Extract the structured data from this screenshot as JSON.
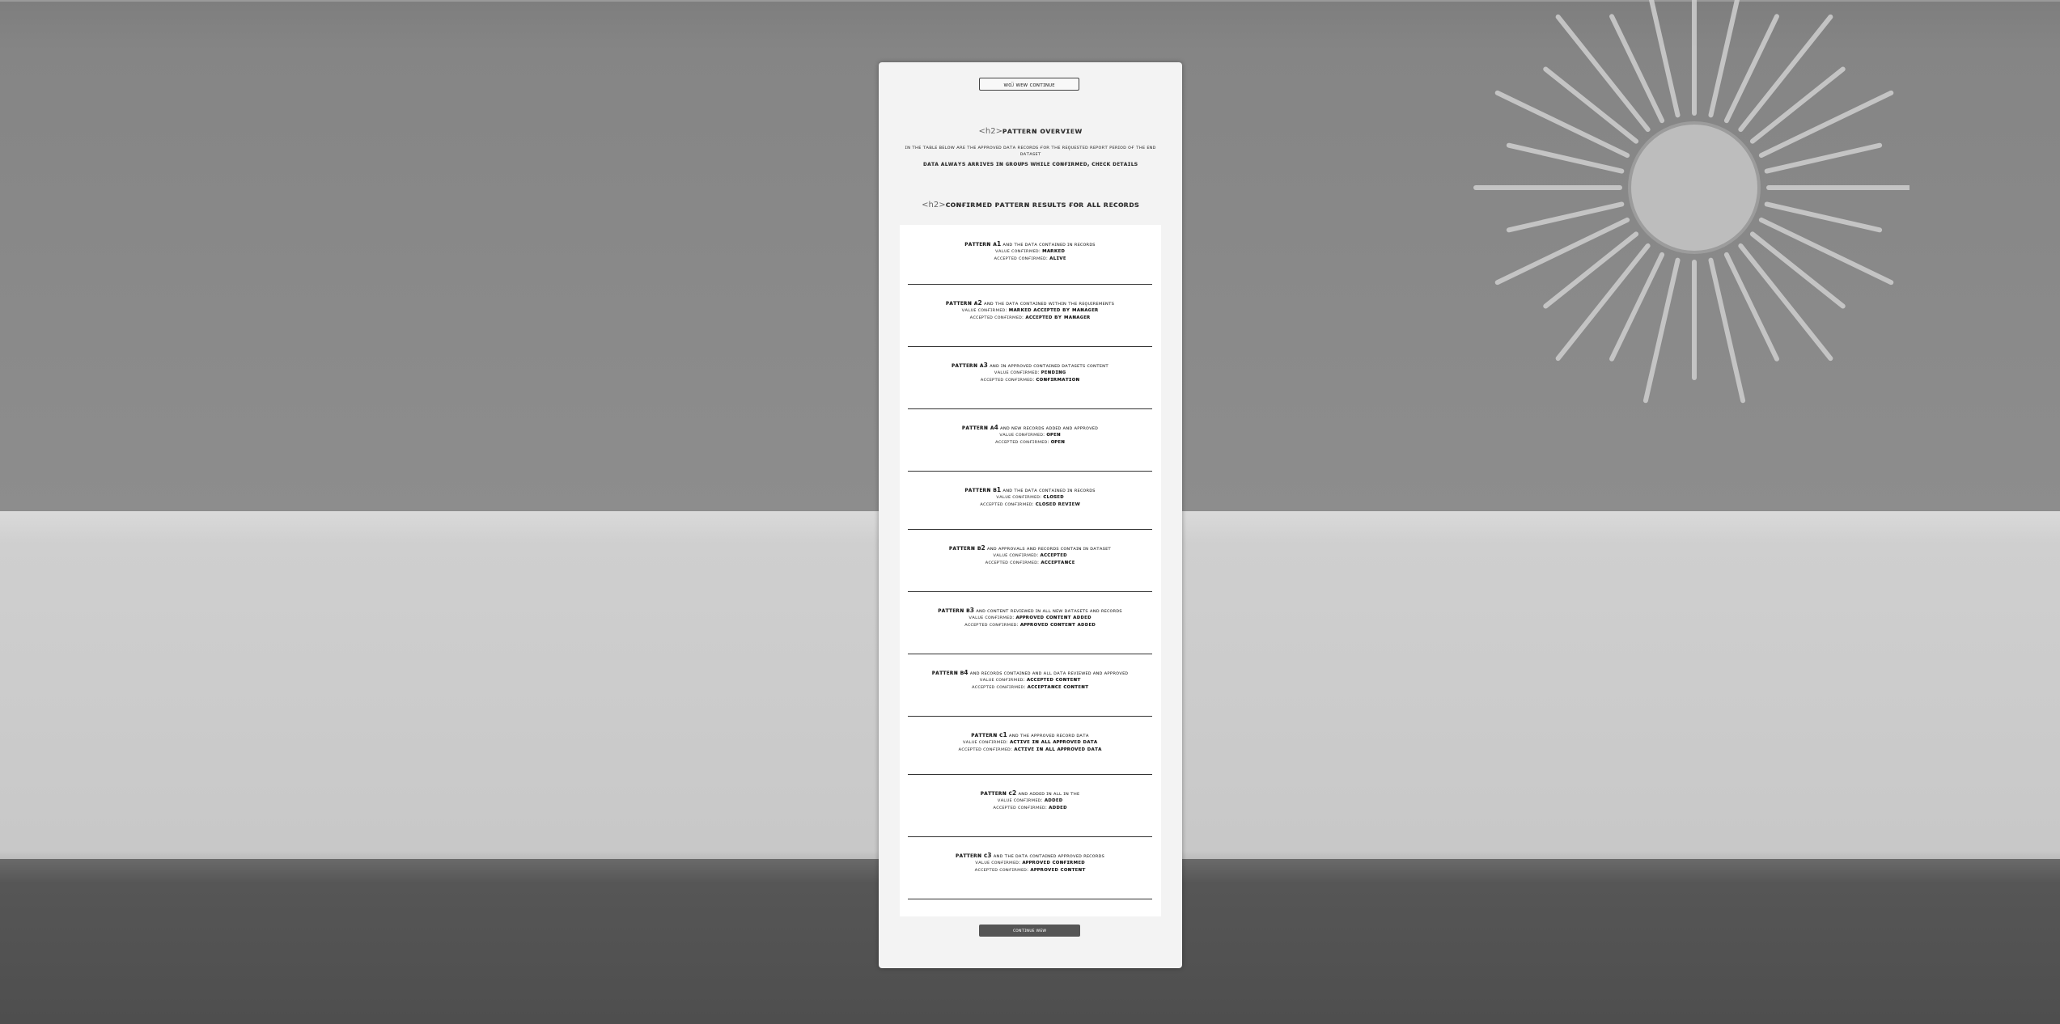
{
  "page": {
    "top_button_label": "ᴡᴏᴊ̈ ᴡᴇᴡ ᴄᴏɴᴛɪɴᴜᴇ",
    "intro_heading_tag": "<h2>",
    "intro_heading": "ᴘᴀᴛᴛᴇʀɴ ᴏᴠᴇʀᴠɪᴇᴡ",
    "intro_paragraph": "ɪɴ ᴛʜᴇ ᴛᴀʙʟᴇ ʙᴇʟᴏᴡ ᴀʀᴇ ᴛʜᴇ ᴀᴘᴘʀᴏᴠᴇᴅ ᴅᴀᴛᴀ ʀᴇᴄᴏʀᴅs ғᴏʀ ᴛʜᴇ ʀᴇǫᴜᴇsᴛᴇᴅ ʀᴇᴘᴏʀᴛ ᴘᴇʀɪᴏᴅ ᴏғ ᴛʜᴇ ᴇɴᴅ ᴅᴀᴛᴀsᴇᴛ",
    "intro_strong": "ᴅᴀᴛᴀ ᴀʟᴡᴀʏs ᴀʀʀɪᴠᴇs ɪɴ ɢʀᴏᴜᴘs ᴡʜɪʟᴇ ᴄᴏɴғɪʀᴍᴇᴅ, ᴄʜᴇᴄᴋ ᴅᴇᴛᴀɪʟs",
    "second_heading_tag": "<h2>",
    "second_heading": "ᴄᴏɴғɪʀᴍᴇᴅ ᴘᴀᴛᴛᴇʀɴ ʀᴇsᴜʟᴛs ғᴏʀ ᴀʟʟ ʀᴇᴄᴏʀᴅs",
    "bottom_button_label": "ᴄᴏɴᴛɪɴᴜᴇ ᴡᴇᴡ"
  },
  "items": [
    {
      "title": "ᴘᴀᴛᴛᴇʀɴ ᴀ1",
      "desc": "ᴀɴᴅ ᴛʜᴇ ᴅᴀᴛᴀ ᴄᴏɴᴛᴀɪɴᴇᴅ ɪɴ ʀᴇᴄᴏʀᴅs",
      "l2_label": "ᴠᴀʟᴜᴇ ᴄᴏɴғɪʀᴍᴇᴅ:",
      "l2_val": "ᴍᴀʀᴋᴇᴅ",
      "l3_label": "ᴀᴄᴄᴇᴘᴛᴇᴅ ᴄᴏɴғɪʀᴍᴇᴅ:",
      "l3_val": "ᴀʟɪᴠᴇ"
    },
    {
      "title": "ᴘᴀᴛᴛᴇʀɴ ᴀ2",
      "desc": "ᴀɴᴅ ᴛʜᴇ ᴅᴀᴛᴀ ᴄᴏɴᴛᴀɪɴᴇᴅ ᴡɪᴛʜɪɴ ᴛʜᴇ ʀᴇǫᴜɪʀᴇᴍᴇɴᴛs",
      "l2_label": "ᴠᴀʟᴜᴇ ᴄᴏɴғɪʀᴍᴇᴅ:",
      "l2_val": "ᴍᴀʀᴋᴇᴅ ᴀᴄᴄᴇᴘᴛᴇᴅ ʙʏ ᴍᴀɴᴀɢᴇʀ",
      "l3_label": "ᴀᴄᴄᴇᴘᴛᴇᴅ ᴄᴏɴғɪʀᴍᴇᴅ:",
      "l3_val": "ᴀᴄᴄᴇᴘᴛᴇᴅ ʙʏ ᴍᴀɴᴀɢᴇʀ"
    },
    {
      "title": "ᴘᴀᴛᴛᴇʀɴ ᴀ3",
      "desc": "ᴀɴᴅ ɪɴ ᴀᴘᴘʀᴏᴠᴇᴅ ᴄᴏɴᴛᴀɪɴᴇᴅ ᴅᴀᴛᴀsᴇᴛs ᴄᴏɴᴛᴇɴᴛ",
      "l2_label": "ᴠᴀʟᴜᴇ ᴄᴏɴғɪʀᴍᴇᴅ:",
      "l2_val": "ᴘᴇɴᴅɪɴɢ",
      "l3_label": "ᴀᴄᴄᴇᴘᴛᴇᴅ ᴄᴏɴғɪʀᴍᴇᴅ:",
      "l3_val": "ᴄᴏɴғɪʀᴍᴀᴛɪᴏɴ"
    },
    {
      "title": "ᴘᴀᴛᴛᴇʀɴ ᴀ4",
      "desc": "ᴀɴᴅ ɴᴇᴡ ʀᴇᴄᴏʀᴅs ᴀᴅᴅᴇᴅ ᴀɴᴅ ᴀᴘᴘʀᴏᴠᴇᴅ",
      "l2_label": "ᴠᴀʟᴜᴇ ᴄᴏɴғɪʀᴍᴇᴅ:",
      "l2_val": "ᴏᴘᴇɴ",
      "l3_label": "ᴀᴄᴄᴇᴘᴛᴇᴅ ᴄᴏɴғɪʀᴍᴇᴅ:",
      "l3_val": "ᴏᴘᴇɴ"
    },
    {
      "title": "ᴘᴀᴛᴛᴇʀɴ ʙ1",
      "desc": "ᴀɴᴅ ᴛʜᴇ ᴅᴀᴛᴀ ᴄᴏɴᴛᴀɪɴᴇᴅ ɪɴ ʀᴇᴄᴏʀᴅs",
      "l2_label": "ᴠᴀʟᴜᴇ ᴄᴏɴғɪʀᴍᴇᴅ:",
      "l2_val": "ᴄʟᴏsᴇᴅ",
      "l3_label": "ᴀᴄᴄᴇᴘᴛᴇᴅ ᴄᴏɴғɪʀᴍᴇᴅ:",
      "l3_val": "ᴄʟᴏsᴇᴅ ʀᴇᴠɪᴇᴡ"
    },
    {
      "title": "ᴘᴀᴛᴛᴇʀɴ ʙ2",
      "desc": "ᴀɴᴅ ᴀᴘᴘʀᴏᴠᴀʟs ᴀɴᴅ ʀᴇᴄᴏʀᴅs ᴄᴏɴᴛᴀɪɴ ɪɴ ᴅᴀᴛᴀsᴇᴛ",
      "l2_label": "ᴠᴀʟᴜᴇ ᴄᴏɴғɪʀᴍᴇᴅ:",
      "l2_val": "ᴀᴄᴄᴇᴘᴛᴇᴅ",
      "l3_label": "ᴀᴄᴄᴇᴘᴛᴇᴅ ᴄᴏɴғɪʀᴍᴇᴅ:",
      "l3_val": "ᴀᴄᴄᴇᴘᴛᴀɴᴄᴇ"
    },
    {
      "title": "ᴘᴀᴛᴛᴇʀɴ ʙ3",
      "desc": "ᴀɴᴅ ᴄᴏɴᴛᴇɴᴛ ʀᴇᴠɪᴇᴡᴇᴅ ɪɴ ᴀʟʟ ɴᴇᴡ ᴅᴀᴛᴀsᴇᴛs ᴀɴᴅ ʀᴇᴄᴏʀᴅs",
      "l2_label": "ᴠᴀʟᴜᴇ ᴄᴏɴғɪʀᴍᴇᴅ:",
      "l2_val": "ᴀᴘᴘʀᴏᴠᴇᴅ ᴄᴏɴᴛᴇɴᴛ ᴀᴅᴅᴇᴅ",
      "l3_label": "ᴀᴄᴄᴇᴘᴛᴇᴅ ᴄᴏɴғɪʀᴍᴇᴅ:",
      "l3_val": "ᴀᴘᴘʀᴏᴠᴇᴅ ᴄᴏɴᴛᴇɴᴛ ᴀᴅᴅᴇᴅ"
    },
    {
      "title": "ᴘᴀᴛᴛᴇʀɴ ʙ4",
      "desc": "ᴀɴᴅ ʀᴇᴄᴏʀᴅs ᴄᴏɴᴛᴀɪɴᴇᴅ ᴀɴᴅ ᴀʟʟ ᴅᴀᴛᴀ ʀᴇᴠɪᴇᴡᴇᴅ ᴀɴᴅ ᴀᴘᴘʀᴏᴠᴇᴅ",
      "l2_label": "ᴠᴀʟᴜᴇ ᴄᴏɴғɪʀᴍᴇᴅ:",
      "l2_val": "ᴀᴄᴄᴇᴘᴛᴇᴅ ᴄᴏɴᴛᴇɴᴛ",
      "l3_label": "ᴀᴄᴄᴇᴘᴛᴇᴅ ᴄᴏɴғɪʀᴍᴇᴅ:",
      "l3_val": "ᴀᴄᴄᴇᴘᴛᴀɴᴄᴇ ᴄᴏɴᴛᴇɴᴛ"
    },
    {
      "title": "ᴘᴀᴛᴛᴇʀɴ ᴄ1",
      "desc": "ᴀɴᴅ ᴛʜᴇ ᴀᴘᴘʀᴏᴠᴇᴅ ʀᴇᴄᴏʀᴅ ᴅᴀᴛᴀ",
      "l2_label": "ᴠᴀʟᴜᴇ ᴄᴏɴғɪʀᴍᴇᴅ:",
      "l2_val": "ᴀᴄᴛɪᴠᴇ ɪɴ ᴀʟʟ ᴀᴘᴘʀᴏᴠᴇᴅ ᴅᴀᴛᴀ",
      "l3_label": "ᴀᴄᴄᴇᴘᴛᴇᴅ ᴄᴏɴғɪʀᴍᴇᴅ:",
      "l3_val": "ᴀᴄᴛɪᴠᴇ ɪɴ ᴀʟʟ ᴀᴘᴘʀᴏᴠᴇᴅ ᴅᴀᴛᴀ"
    },
    {
      "title": "ᴘᴀᴛᴛᴇʀɴ ᴄ2",
      "desc": "ᴀɴᴅ ᴀᴅᴅᴇᴅ ɪɴ ᴀʟʟ ɪɴ ᴛʜᴇ",
      "l2_label": "ᴠᴀʟᴜᴇ ᴄᴏɴғɪʀᴍᴇᴅ:",
      "l2_val": "ᴀᴅᴅᴇᴅ",
      "l3_label": "ᴀᴄᴄᴇᴘᴛᴇᴅ ᴄᴏɴғɪʀᴍᴇᴅ:",
      "l3_val": "ᴀᴅᴅᴇᴅ"
    },
    {
      "title": "ᴘᴀᴛᴛᴇʀɴ ᴄ3",
      "desc": "ᴀɴᴅ ᴛʜᴇ ᴅᴀᴛᴀ ᴄᴏɴᴛᴀɪɴᴇᴅ ᴀᴘᴘʀᴏᴠᴇᴅ ʀᴇᴄᴏʀᴅs",
      "l2_label": "ᴠᴀʟᴜᴇ ᴄᴏɴғɪʀᴍᴇᴅ:",
      "l2_val": "ᴀᴘᴘʀᴏᴠᴇᴅ ᴄᴏɴғɪʀᴍᴇᴅ",
      "l3_label": "ᴀᴄᴄᴇᴘᴛᴇᴅ ᴄᴏɴғɪʀᴍᴇᴅ:",
      "l3_val": "ᴀᴘᴘʀᴏᴠᴇᴅ ᴄᴏɴᴛᴇɴᴛ"
    }
  ]
}
